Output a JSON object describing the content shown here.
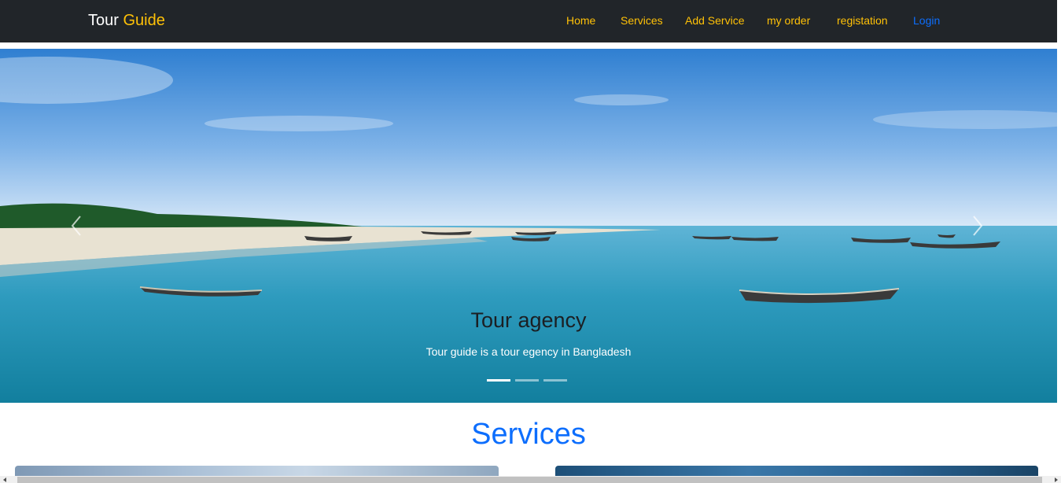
{
  "navbar": {
    "brand_part1": "Tour",
    "brand_part2": "Guide",
    "links": [
      "Home",
      "Services",
      "Add Service",
      "my order",
      "registation",
      "Login"
    ]
  },
  "carousel": {
    "caption_title": "Tour agency",
    "caption_text": "Tour guide is a tour egency in Bangladesh",
    "slides_total": 3,
    "active_slide": 1
  },
  "services": {
    "heading": "Services"
  },
  "colors": {
    "navbar_bg": "#212529",
    "nav_link": "#ffc107",
    "login_link": "#0d6efd",
    "heading": "#0d6efd"
  },
  "icons": [
    "chevron-left-icon",
    "chevron-right-icon"
  ]
}
